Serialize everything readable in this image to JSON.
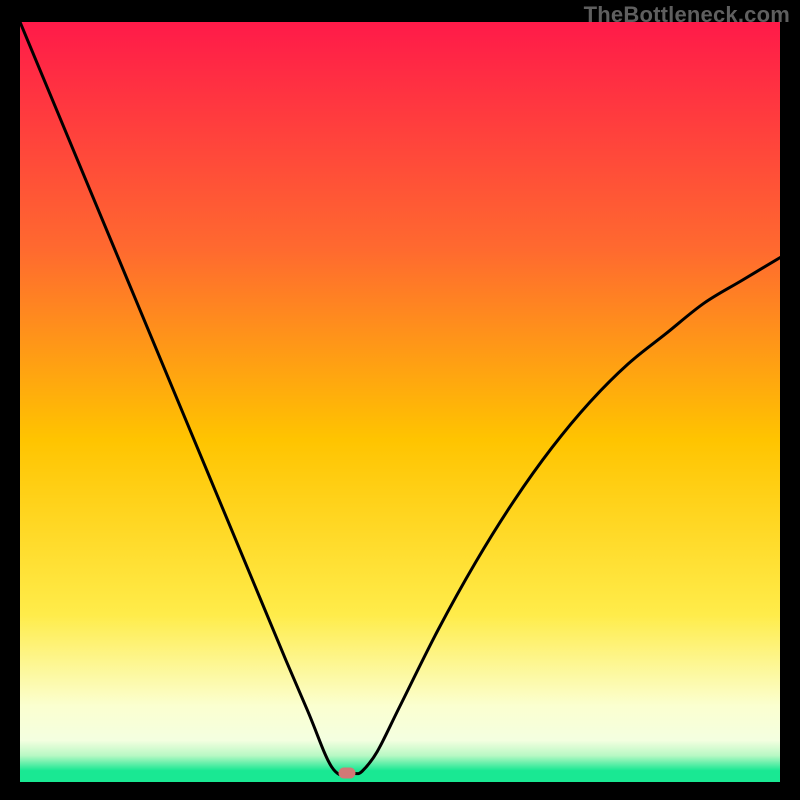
{
  "watermark": "TheBottleneck.com",
  "colors": {
    "top": "#ff1a49",
    "mid_upper": "#ff8a2a",
    "mid": "#ffd400",
    "mid_lower": "#ffee55",
    "pale": "#fbffd0",
    "green": "#19e893",
    "curve": "#000000",
    "marker": "#d17876",
    "frame_bg": "#000000"
  },
  "chart_data": {
    "type": "line",
    "title": "",
    "xlabel": "",
    "ylabel": "",
    "xlim": [
      0,
      100
    ],
    "ylim": [
      0,
      100
    ],
    "optimum_x": 42,
    "marker": {
      "x": 43,
      "y": 1.2
    },
    "series": [
      {
        "name": "bottleneck-curve",
        "x": [
          0,
          5,
          10,
          15,
          20,
          25,
          30,
          35,
          38,
          40,
          41,
          42,
          43,
          44,
          45,
          47,
          50,
          55,
          60,
          65,
          70,
          75,
          80,
          85,
          90,
          95,
          100
        ],
        "y": [
          100,
          88,
          76,
          64,
          52,
          40,
          28,
          16,
          9,
          4,
          2,
          1.0,
          1.0,
          1.1,
          1.4,
          4,
          10,
          20,
          29,
          37,
          44,
          50,
          55,
          59,
          63,
          66,
          69
        ]
      }
    ],
    "gradient_stops": [
      {
        "offset": 0.0,
        "color": "#ff1a49"
      },
      {
        "offset": 0.3,
        "color": "#ff6a2f"
      },
      {
        "offset": 0.55,
        "color": "#ffc400"
      },
      {
        "offset": 0.78,
        "color": "#ffec4a"
      },
      {
        "offset": 0.9,
        "color": "#fbffd0"
      },
      {
        "offset": 0.945,
        "color": "#f4ffe0"
      },
      {
        "offset": 0.965,
        "color": "#b9f8c4"
      },
      {
        "offset": 0.985,
        "color": "#19e893"
      },
      {
        "offset": 1.0,
        "color": "#19e893"
      }
    ]
  }
}
